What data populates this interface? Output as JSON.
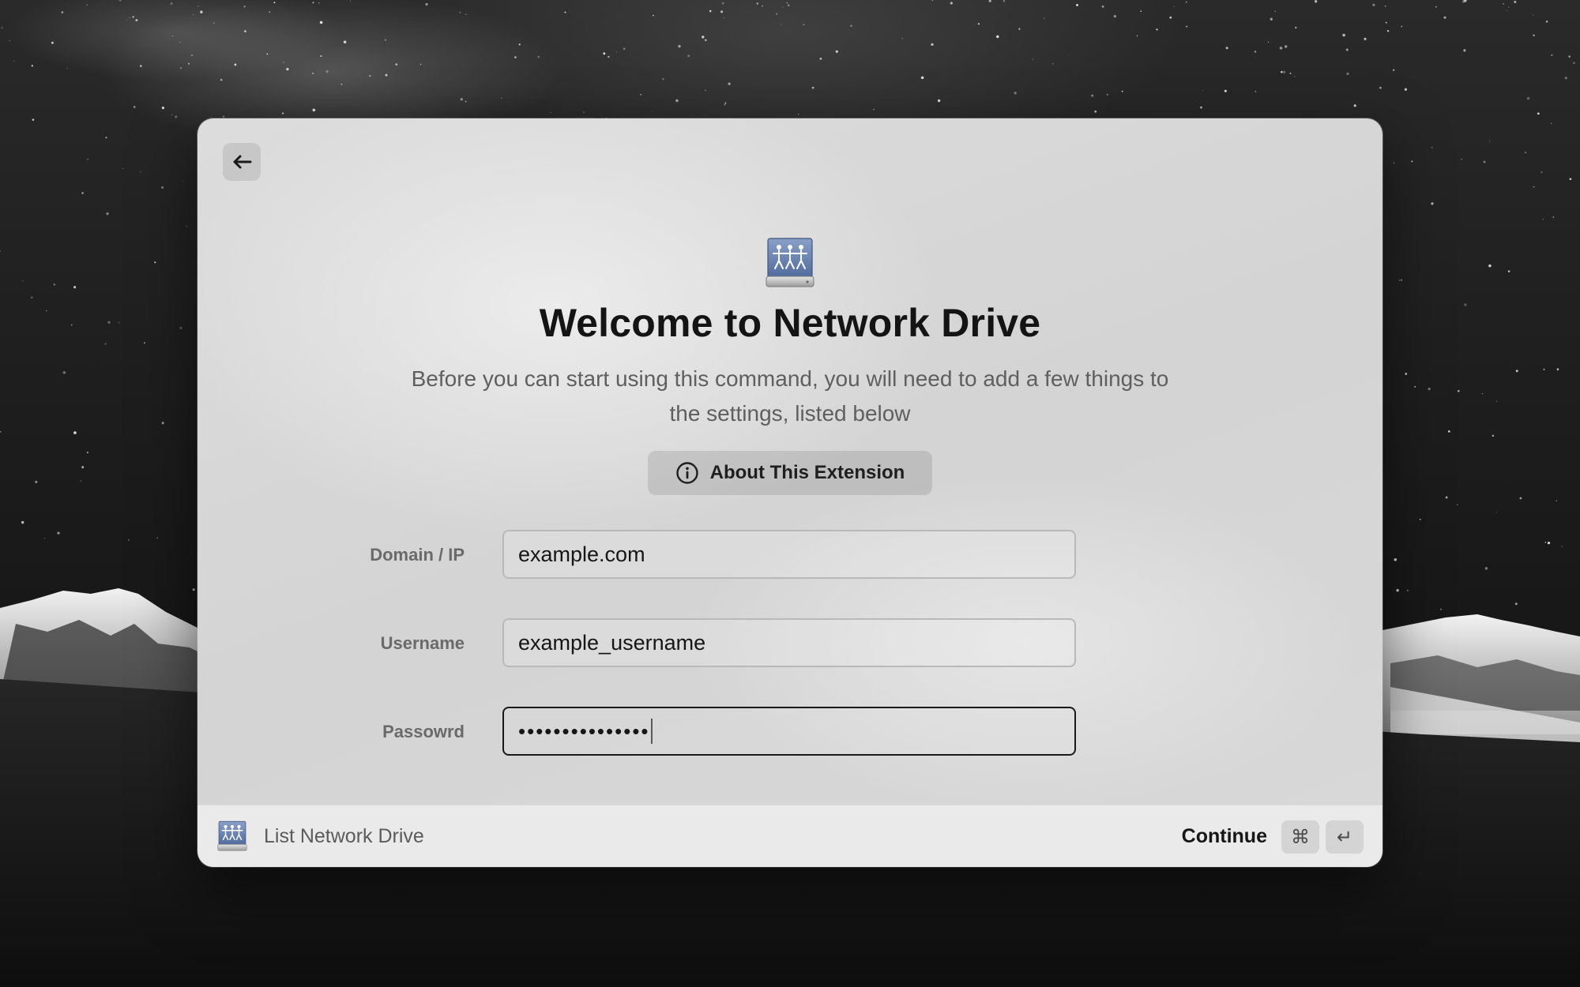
{
  "window": {
    "title": "Welcome to Network Drive",
    "subtitle": "Before you can start using this command, you will need to add a few things to the settings, listed below",
    "about_button_label": "About This Extension",
    "back_icon": "arrow-left-icon",
    "hero_icon": "network-drive-icon"
  },
  "form": {
    "domain": {
      "label": "Domain / IP",
      "value": "example.com"
    },
    "username": {
      "label": "Username",
      "value": "example_username"
    },
    "password": {
      "label": "Passowrd",
      "masked_value": "•••••••••••••••"
    }
  },
  "footer": {
    "command_title": "List Network Drive",
    "continue_label": "Continue",
    "shortcut_keys": [
      "⌘",
      "↵"
    ]
  },
  "colors": {
    "window_background": "#d8d8d8",
    "title_text": "#141414",
    "subtitle_text": "#5f5f5f",
    "drive_icon_blue": "#6f86b3",
    "focused_border": "#1a1a1a"
  }
}
